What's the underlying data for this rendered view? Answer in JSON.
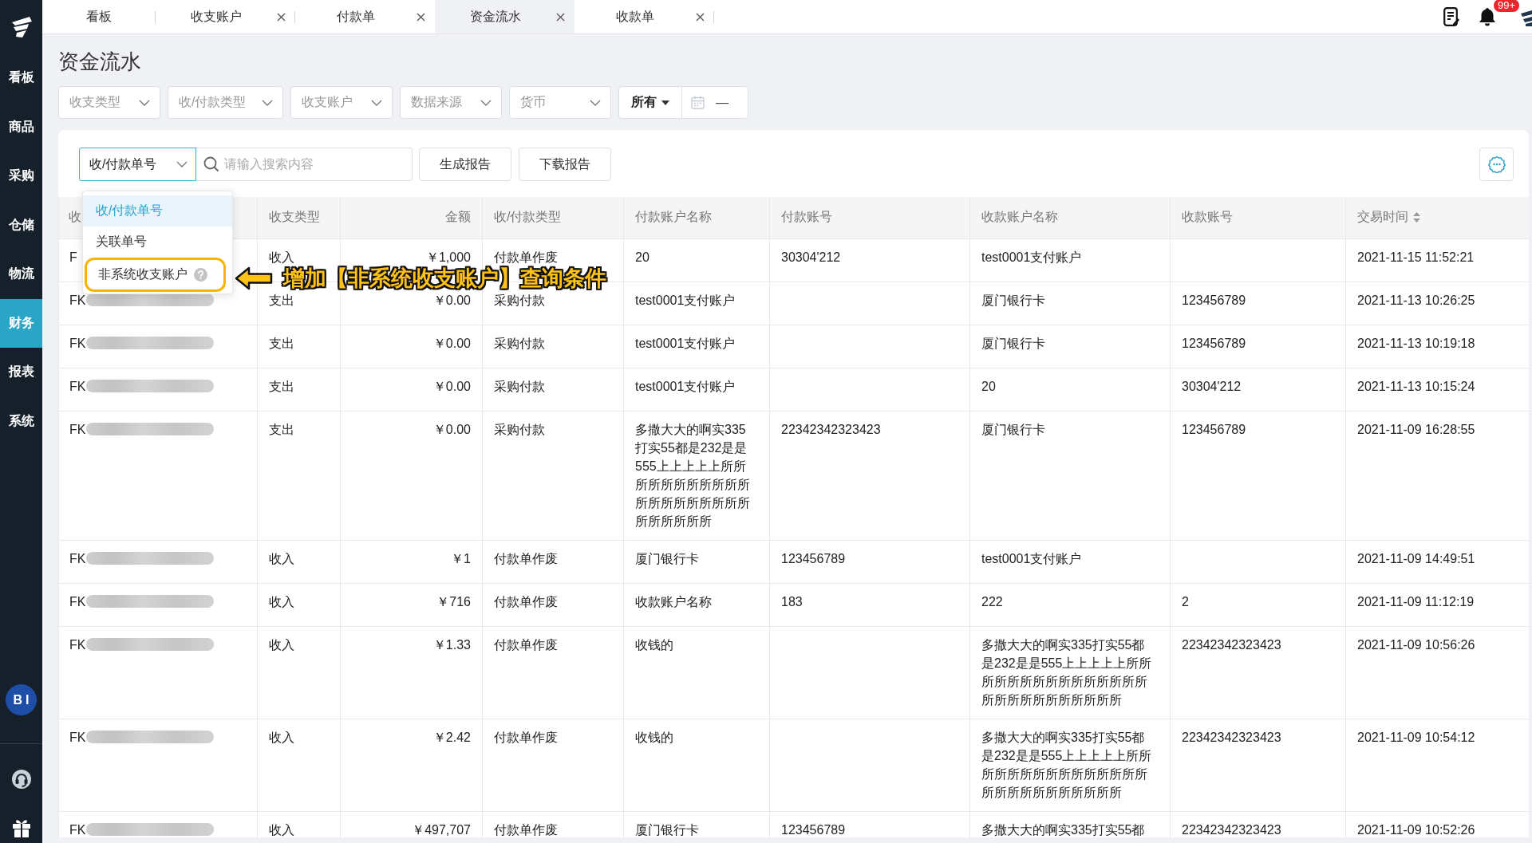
{
  "sidebar": {
    "items": [
      {
        "label": "看板",
        "selected": false
      },
      {
        "label": "商品",
        "selected": false
      },
      {
        "label": "采购",
        "selected": false
      },
      {
        "label": "仓储",
        "selected": false
      },
      {
        "label": "物流",
        "selected": false
      },
      {
        "label": "财务",
        "selected": true
      },
      {
        "label": "报表",
        "selected": false
      },
      {
        "label": "系统",
        "selected": false
      }
    ],
    "bi_label": "BI"
  },
  "tabs": [
    {
      "label": "看板",
      "selected": false,
      "closable": false
    },
    {
      "label": "收支账户",
      "selected": false,
      "closable": true
    },
    {
      "label": "付款单",
      "selected": false,
      "closable": true
    },
    {
      "label": "资金流水",
      "selected": true,
      "closable": true
    },
    {
      "label": "收款单",
      "selected": false,
      "closable": true
    }
  ],
  "header": {
    "notification_count": "99+"
  },
  "page_title": "资金流水",
  "filters": [
    {
      "placeholder": "收支类型"
    },
    {
      "placeholder": "收/付款类型"
    },
    {
      "placeholder": "收支账户"
    },
    {
      "placeholder": "数据来源"
    },
    {
      "placeholder": "货币"
    }
  ],
  "date_filter": {
    "period": "所有",
    "range_separator": "—"
  },
  "search": {
    "field": "收/付款单号",
    "expanded": true,
    "placeholder": "请输入搜索内容",
    "options": [
      {
        "label": "收/付款单号",
        "selected": true,
        "highlighted": false,
        "help": false
      },
      {
        "label": "关联单号",
        "selected": false,
        "highlighted": false,
        "help": false
      },
      {
        "label": "非系统收支账户",
        "selected": false,
        "highlighted": true,
        "help": true
      }
    ]
  },
  "buttons": [
    "生成报告",
    "下载报告"
  ],
  "table": {
    "columns": [
      {
        "label": "收",
        "sortable": false
      },
      {
        "label": "收支类型",
        "sortable": false
      },
      {
        "label": "金额",
        "sortable": false
      },
      {
        "label": "收/付款类型",
        "sortable": false
      },
      {
        "label": "付款账户名称",
        "sortable": false
      },
      {
        "label": "付款账号",
        "sortable": false
      },
      {
        "label": "收款账户名称",
        "sortable": false
      },
      {
        "label": "收款账号",
        "sortable": false
      },
      {
        "label": "交易时间",
        "sortable": true
      }
    ],
    "rows": [
      {
        "column_1": "F",
        "redacted": false,
        "flow_type": "收入",
        "amount": "￥1,000",
        "payment_type": "付款单作废",
        "payer_account_name": "20",
        "payer_account_number": "30304'212",
        "payee_account_name": "test0001支付账户",
        "time": "2021-11-15 11:52:21"
      },
      {
        "column_1": "FK",
        "redacted": true,
        "flow_type": "支出",
        "amount": "￥0.00",
        "payment_type": "采购付款",
        "payer_account_name": "test0001支付账户",
        "payee_account_name": "厦门银行卡",
        "payee_account_number": "123456789",
        "time": "2021-11-13 10:26:25"
      },
      {
        "column_1": "FK",
        "redacted": true,
        "flow_type": "支出",
        "amount": "￥0.00",
        "payment_type": "采购付款",
        "payer_account_name": "test0001支付账户",
        "payee_account_name": "厦门银行卡",
        "payee_account_number": "123456789",
        "time": "2021-11-13 10:19:18"
      },
      {
        "column_1": "FK",
        "redacted": true,
        "flow_type": "支出",
        "amount": "￥0.00",
        "payment_type": "采购付款",
        "payer_account_name": "test0001支付账户",
        "payee_account_name": "20",
        "payee_account_number": "30304'212",
        "time": "2021-11-13 10:15:24"
      },
      {
        "column_1": "FK",
        "redacted": true,
        "flow_type": "支出",
        "amount": "￥0.00",
        "payment_type": "采购付款",
        "payer_account_name": "多撒大大的啊实335打实55都是232是是555上上上上上所所所所所所所所所所所所所所所所所所所所所所所所所所",
        "payer_account_number": "22342342323423",
        "payee_account_name": "厦门银行卡",
        "payee_account_number": "123456789",
        "time": "2021-11-09 16:28:55"
      },
      {
        "column_1": "FK",
        "redacted": true,
        "flow_type": "收入",
        "amount": "￥1",
        "payment_type": "付款单作废",
        "payer_account_name": "厦门银行卡",
        "payer_account_number": "123456789",
        "payee_account_name": "test0001支付账户",
        "time": "2021-11-09 14:49:51"
      },
      {
        "column_1": "FK",
        "redacted": true,
        "flow_type": "收入",
        "amount": "￥716",
        "payment_type": "付款单作废",
        "payer_account_name": "收款账户名称",
        "payer_account_number": "183",
        "payee_account_name": "222",
        "payee_account_number": "2",
        "time": "2021-11-09 11:12:19"
      },
      {
        "column_1": "FK",
        "redacted": true,
        "flow_type": "收入",
        "amount": "￥1.33",
        "payment_type": "付款单作废",
        "payer_account_name": "收钱的",
        "payee_account_name": "多撒大大的啊实335打实55都是232是是555上上上上上所所所所所所所所所所所所所所所所所所所所所所所所所所",
        "payee_account_number": "22342342323423",
        "time": "2021-11-09 10:56:26"
      },
      {
        "column_1": "FK",
        "redacted": true,
        "flow_type": "收入",
        "amount": "￥2.42",
        "payment_type": "付款单作废",
        "payer_account_name": "收钱的",
        "payee_account_name": "多撒大大的啊实335打实55都是232是是555上上上上上所所所所所所所所所所所所所所所所所所所所所所所所所所",
        "payee_account_number": "22342342323423",
        "time": "2021-11-09 10:54:12"
      },
      {
        "column_1": "FK",
        "redacted": true,
        "flow_type": "收入",
        "amount": "￥497,707",
        "payment_type": "付款单作废",
        "payer_account_name": "厦门银行卡",
        "payer_account_number": "123456789",
        "payee_account_name": "多撒大大的啊实335打实55都",
        "payee_account_number": "22342342323423",
        "time": "2021-11-09 10:52:26"
      }
    ]
  },
  "annotation": {
    "text": "增加【非系统收支账户】查询条件"
  }
}
